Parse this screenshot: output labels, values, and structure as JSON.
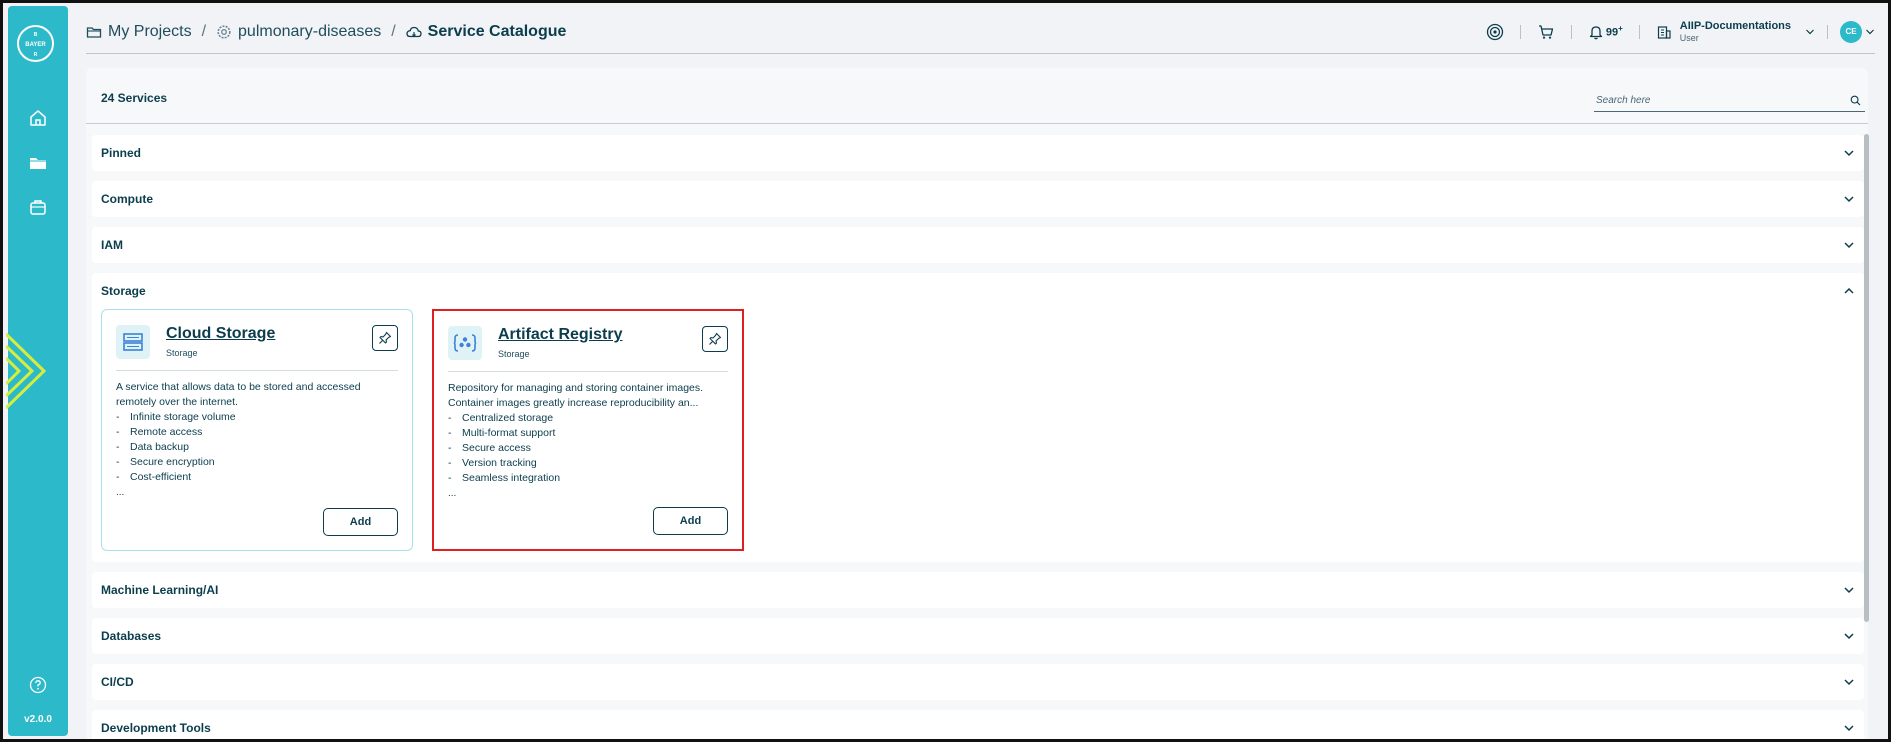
{
  "sidebar": {
    "logo_text": "BAYER",
    "nav": [
      {
        "icon": "home-icon"
      },
      {
        "icon": "folder-icon"
      },
      {
        "icon": "bag-icon"
      }
    ],
    "help_icon": "help-icon",
    "version": "v2.0.0"
  },
  "breadcrumb": [
    {
      "label": "My Projects",
      "icon": "folder-icon"
    },
    {
      "label": "pulmonary-diseases",
      "icon": "gear-icon"
    },
    {
      "label": "Service Catalogue",
      "icon": "cloud-icon"
    }
  ],
  "breadcrumb_separator": "/",
  "header": {
    "notifications_count": "99",
    "notifications_plus": "+",
    "org_name": "AIIP-Documentations",
    "org_role": "User",
    "avatar_initials": "CE"
  },
  "catalogue": {
    "count_label": "24 Services",
    "search_placeholder": "Search here"
  },
  "sections": [
    {
      "title": "Pinned",
      "expanded": false
    },
    {
      "title": "Compute",
      "expanded": false
    },
    {
      "title": "IAM",
      "expanded": false
    },
    {
      "title": "Storage",
      "expanded": true
    },
    {
      "title": "Machine Learning/AI",
      "expanded": false
    },
    {
      "title": "Databases",
      "expanded": false
    },
    {
      "title": "CI/CD",
      "expanded": false
    },
    {
      "title": "Development Tools",
      "expanded": false
    }
  ],
  "cards": [
    {
      "title": "Cloud Storage",
      "category": "Storage",
      "description": "A service that allows data to be stored and accessed remotely over the internet.",
      "features": [
        "Infinite storage volume",
        "Remote access",
        "Data backup",
        "Secure encryption",
        "Cost-efficient"
      ],
      "more": "...",
      "add_label": "Add",
      "selected": false
    },
    {
      "title": "Artifact Registry",
      "category": "Storage",
      "description": "Repository for managing and storing container images. Container images greatly increase reproducibility an...",
      "features": [
        "Centralized storage",
        "Multi-format support",
        "Secure access",
        "Version tracking",
        "Seamless integration"
      ],
      "more": "...",
      "add_label": "Add",
      "selected": true
    }
  ],
  "colors": {
    "sidebar": "#2cb9c9",
    "text": "#0b3d4d",
    "selection": "#e02020"
  }
}
